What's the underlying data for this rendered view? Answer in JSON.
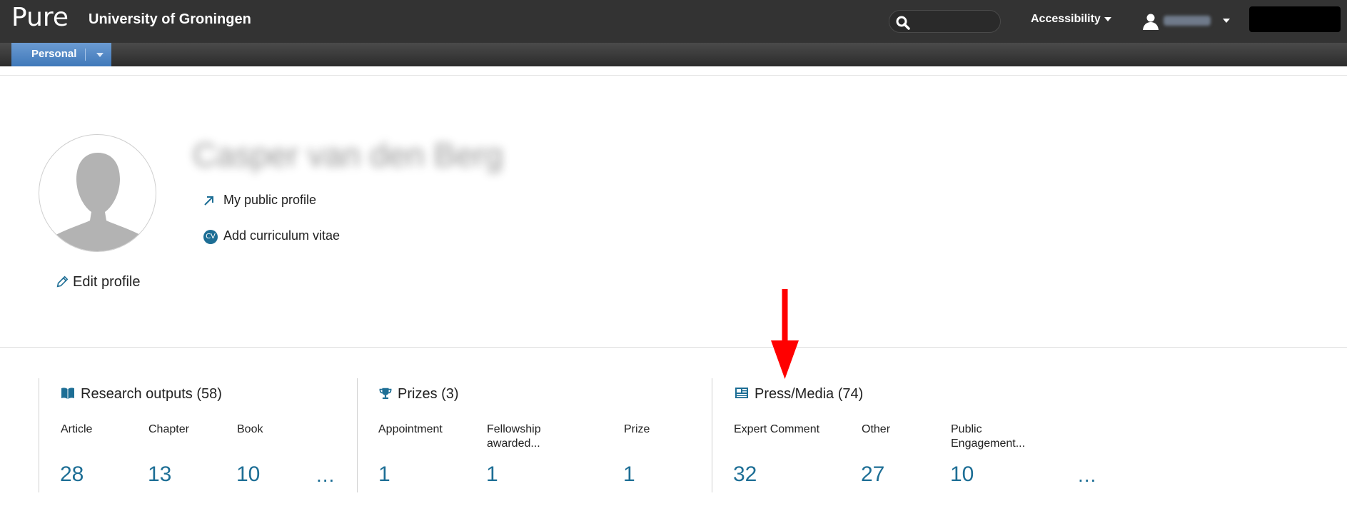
{
  "topbar": {
    "brand": "Pure",
    "organization": "University of Groningen",
    "search_placeholder": "",
    "accessibility_label": "Accessibility",
    "user_name": "",
    "search_icon": "search-icon",
    "user_icon": "user-icon"
  },
  "subbar": {
    "personal_label": "Personal"
  },
  "profile": {
    "name": "Casper van den Berg",
    "public_profile_label": "My public profile",
    "add_cv_label": "Add curriculum vitae",
    "cv_badge": "CV",
    "edit_profile_label": "Edit profile"
  },
  "sections": {
    "research": {
      "title": "Research outputs (58)",
      "icon": "book-icon",
      "cols": [
        {
          "label": "Article",
          "value": "28"
        },
        {
          "label": "Chapter",
          "value": "13"
        },
        {
          "label": "Book",
          "value": "10"
        }
      ],
      "more": "..."
    },
    "prizes": {
      "title": "Prizes (3)",
      "icon": "trophy-icon",
      "cols": [
        {
          "label": "Appointment",
          "value": "1"
        },
        {
          "label": "Fellowship awarded...",
          "value": "1"
        },
        {
          "label": "Prize",
          "value": "1"
        }
      ]
    },
    "press": {
      "title": "Press/Media (74)",
      "icon": "newspaper-icon",
      "cols": [
        {
          "label": "Expert Comment",
          "value": "32"
        },
        {
          "label": "Other",
          "value": "27"
        },
        {
          "label": "Public Engagement...",
          "value": "10"
        }
      ],
      "more": "..."
    }
  },
  "colors": {
    "topbar": "#333333",
    "accent_blue": "#1d6e95",
    "personal_tab": "#3f78b9",
    "annotation_arrow": "#ff0000"
  }
}
